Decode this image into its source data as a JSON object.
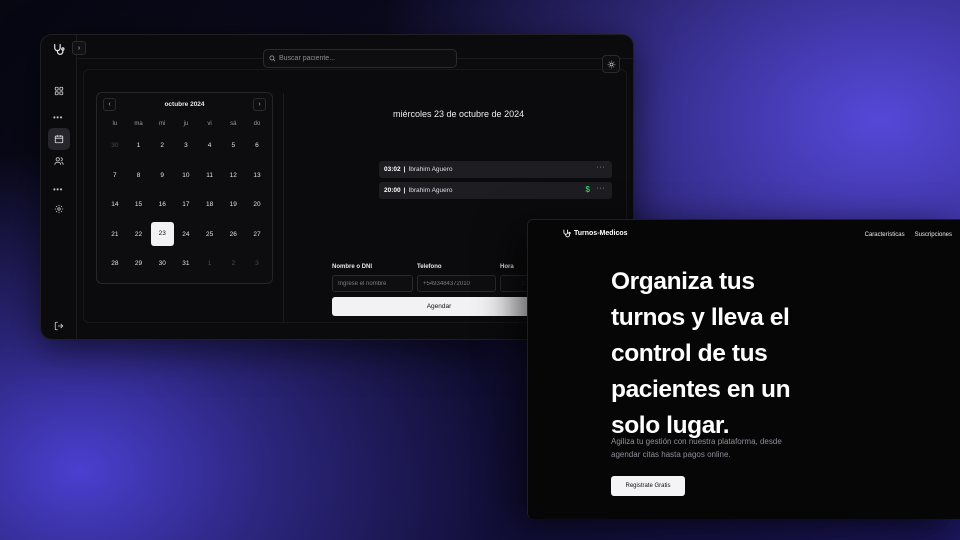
{
  "app": {
    "search": {
      "placeholder": "Buscar paciente..."
    },
    "sidebar": {
      "items": [
        {
          "icon": "grid-icon"
        },
        {
          "icon": "calendar-icon",
          "active": true
        },
        {
          "icon": "users-icon"
        },
        {
          "icon": "settings-icon"
        },
        {
          "icon": "logout-icon"
        }
      ]
    },
    "calendar": {
      "month_label": "octubre 2024",
      "weekdays": [
        "lu",
        "ma",
        "mi",
        "ju",
        "vi",
        "sá",
        "do"
      ],
      "weeks": [
        [
          {
            "d": "30",
            "muted": true
          },
          {
            "d": "1"
          },
          {
            "d": "2"
          },
          {
            "d": "3"
          },
          {
            "d": "4"
          },
          {
            "d": "5"
          },
          {
            "d": "6"
          }
        ],
        [
          {
            "d": "7"
          },
          {
            "d": "8"
          },
          {
            "d": "9"
          },
          {
            "d": "10"
          },
          {
            "d": "11"
          },
          {
            "d": "12"
          },
          {
            "d": "13"
          }
        ],
        [
          {
            "d": "14"
          },
          {
            "d": "15"
          },
          {
            "d": "16"
          },
          {
            "d": "17"
          },
          {
            "d": "18"
          },
          {
            "d": "19"
          },
          {
            "d": "20"
          }
        ],
        [
          {
            "d": "21"
          },
          {
            "d": "22"
          },
          {
            "d": "23",
            "selected": true
          },
          {
            "d": "24"
          },
          {
            "d": "25"
          },
          {
            "d": "26"
          },
          {
            "d": "27"
          }
        ],
        [
          {
            "d": "28"
          },
          {
            "d": "29"
          },
          {
            "d": "30"
          },
          {
            "d": "31"
          },
          {
            "d": "1",
            "muted": true
          },
          {
            "d": "2",
            "muted": true
          },
          {
            "d": "3",
            "muted": true
          }
        ]
      ]
    },
    "schedule": {
      "day_title": "miércoles 23 de octubre de 2024",
      "appointments": [
        {
          "time": "03:02",
          "sep": "|",
          "patient": "Ibrahim Aguero",
          "paid": false
        },
        {
          "time": "20:00",
          "sep": "|",
          "patient": "Ibrahim Aguero",
          "paid": true,
          "paid_symbol": "$"
        }
      ],
      "more_symbol": "···"
    },
    "form": {
      "name_label": "Nombre o DNI",
      "name_placeholder": "Ingrese el nombre",
      "phone_label": "Telefono",
      "phone_value": "+5493484372010",
      "time_label": "Hora",
      "time_value": ":",
      "submit_label": "Agendar"
    }
  },
  "landing": {
    "brand": "Turnos-Medicos",
    "nav": [
      "Características",
      "Suscripciones"
    ],
    "hero_lines": [
      "Organiza tus",
      "turnos y lleva el",
      "control de tus",
      "pacientes en un",
      "solo lugar."
    ],
    "subtitle": "Agiliza tu gestión con nuestra plataforma, desde agendar citas hasta pagos online.",
    "cta_label": "Registrate Gratis"
  },
  "colors": {
    "accent_purple": "#5548d8",
    "paid_green": "#36c26a",
    "window_bg": "#0b0b0d"
  }
}
